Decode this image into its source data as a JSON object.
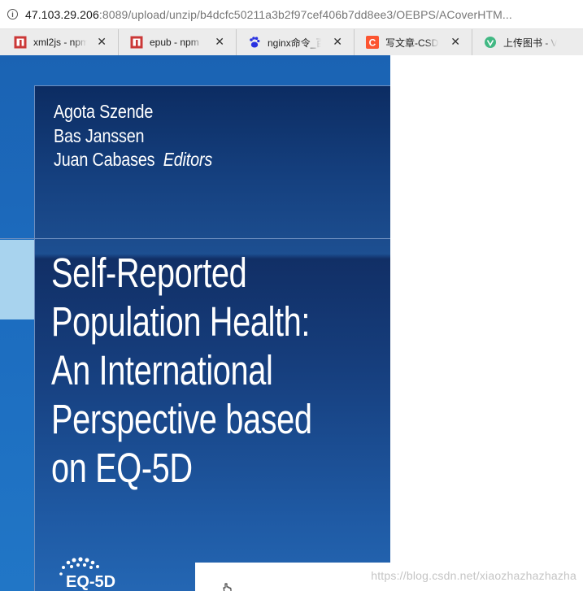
{
  "browser": {
    "url": {
      "host": "47.103.29.206",
      "rest": ":8089/upload/unzip/b4dcfc50211a3b2f97cef406b7dd8ee3/OEBPS/ACoverHTM..."
    },
    "tabs": [
      {
        "title": "xml2js - npm",
        "icon": "npm-icon",
        "color": "#cb3837"
      },
      {
        "title": "epub - npm",
        "icon": "npm-icon",
        "color": "#cb3837"
      },
      {
        "title": "nginx命令_百度",
        "icon": "baidu-paw-icon",
        "color": "#2932e1"
      },
      {
        "title": "写文章-CSDN",
        "icon": "csdn-icon",
        "color": "#fc5531"
      },
      {
        "title": "上传图书 - Vue",
        "icon": "vue-icon",
        "color": "#41b883"
      }
    ]
  },
  "cover": {
    "editors": [
      "Agota Szende",
      "Bas Janssen",
      "Juan Cabases"
    ],
    "editors_role": "Editors",
    "title_lines": [
      "Self-Reported",
      "Population Health:",
      "An International",
      "Perspective based",
      "on EQ-5D"
    ],
    "logo_text": "EQ-5D",
    "colors": {
      "background": "#1b63b3",
      "panel": "#0c2c62",
      "accent_bar": "#a8d3ee"
    }
  },
  "watermark": "https://blog.csdn.net/xiaozhazhazhazha"
}
